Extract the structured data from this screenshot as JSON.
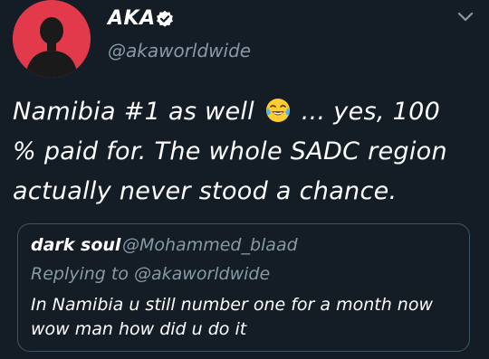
{
  "tweet": {
    "author": {
      "name": "AKA",
      "handle": "@akaworldwide",
      "verified": true,
      "avatar_color": "#e23a4a"
    },
    "text_lines": [
      "Namibia #1 as well",
      "... yes, 100",
      "% paid for. The whole SADC region",
      "actually never stood a chance."
    ],
    "emoji": "face-with-tears-of-joy"
  },
  "quoted_tweet": {
    "author_name": "dark soul",
    "handle": "@Mohammed_blaad",
    "replying_to": "Replying to @akaworldwide",
    "text_lines": [
      "In Namibia u still number one for a month now",
      "wow man how did  u do it"
    ]
  },
  "colors": {
    "background": "#141d26",
    "text": "#ffffff",
    "secondary_text": "#8899a6",
    "card_border": "#3d5466",
    "verified_badge": "#ffffff"
  }
}
